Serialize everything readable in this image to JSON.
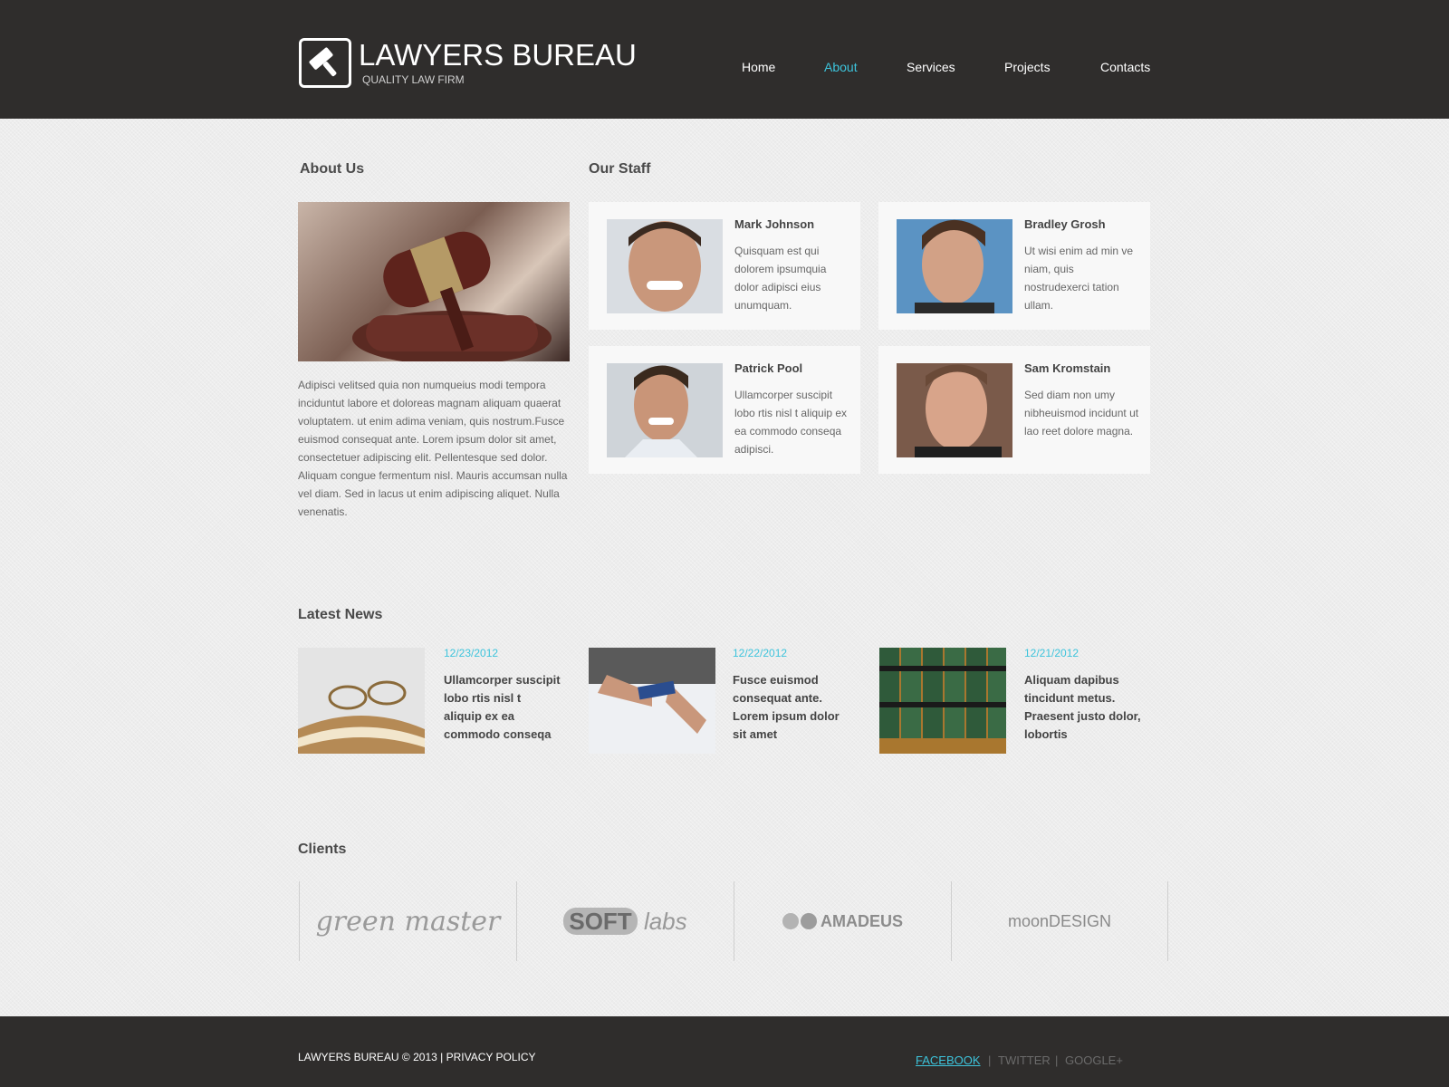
{
  "brand": {
    "title": "LAWYERS BUREAU",
    "subtitle": "QUALITY LAW FIRM"
  },
  "nav": [
    {
      "label": "Home",
      "active": false
    },
    {
      "label": "About",
      "active": true
    },
    {
      "label": "Services",
      "active": false
    },
    {
      "label": "Projects",
      "active": false
    },
    {
      "label": "Contacts",
      "active": false
    }
  ],
  "about": {
    "heading": "About Us",
    "text": "Adipisci velitsed quia non numqueius modi tempora inciduntut labore et doloreas magnam aliquam quaerat voluptatem. ut enim adima veniam, quis nostrum.Fusce euismod consequat ante. Lorem ipsum dolor sit amet, consectetuer adipiscing elit. Pellentesque sed dolor. Aliquam congue fermentum nisl. Mauris accumsan nulla vel diam. Sed in lacus ut enim adipiscing aliquet. Nulla venenatis."
  },
  "staff": {
    "heading": "Our Staff",
    "members": [
      {
        "name": "Mark Johnson",
        "desc": "Quisquam est qui dolorem ipsumquia dolor adipisci eius unumquam."
      },
      {
        "name": "Bradley Grosh",
        "desc": "Ut wisi enim ad min ve niam, quis nostrudexerci tation ullam."
      },
      {
        "name": "Patrick Pool",
        "desc": "Ullamcorper suscipit lobo rtis nisl t aliquip ex ea commodo conseqa adipisci."
      },
      {
        "name": "Sam Kromstain",
        "desc": "Sed diam non umy nibheuismod incidunt ut lao reet dolore magna."
      }
    ]
  },
  "news": {
    "heading": "Latest News",
    "items": [
      {
        "date": "12/23/2012",
        "title": "Ullamcorper suscipit lobo rtis nisl t aliquip ex ea commodo conseqa"
      },
      {
        "date": "12/22/2012",
        "title": "Fusce euismod consequat ante. Lorem ipsum dolor sit amet"
      },
      {
        "date": "12/21/2012",
        "title": "Aliquam dapibus tincidunt metus. Praesent justo dolor, lobortis"
      }
    ]
  },
  "clients": {
    "heading": "Clients",
    "logos": [
      {
        "name": "green master"
      },
      {
        "name_a": "SOFT",
        "name_b": "labs"
      },
      {
        "name": "AMADEUS"
      },
      {
        "name": "moonDESIGN"
      }
    ]
  },
  "footer": {
    "copyright": "LAWYERS BUREAU © 2013 | PRIVACY POLICY",
    "social": [
      "FACEBOOK",
      "TWITTER",
      "GOOGLE+"
    ],
    "separator": "|"
  },
  "colors": {
    "accent": "#3dc4dc",
    "header_bg": "#2f2d2c",
    "page_bg": "#ededed"
  },
  "icons": {
    "logo": "gavel-icon"
  }
}
